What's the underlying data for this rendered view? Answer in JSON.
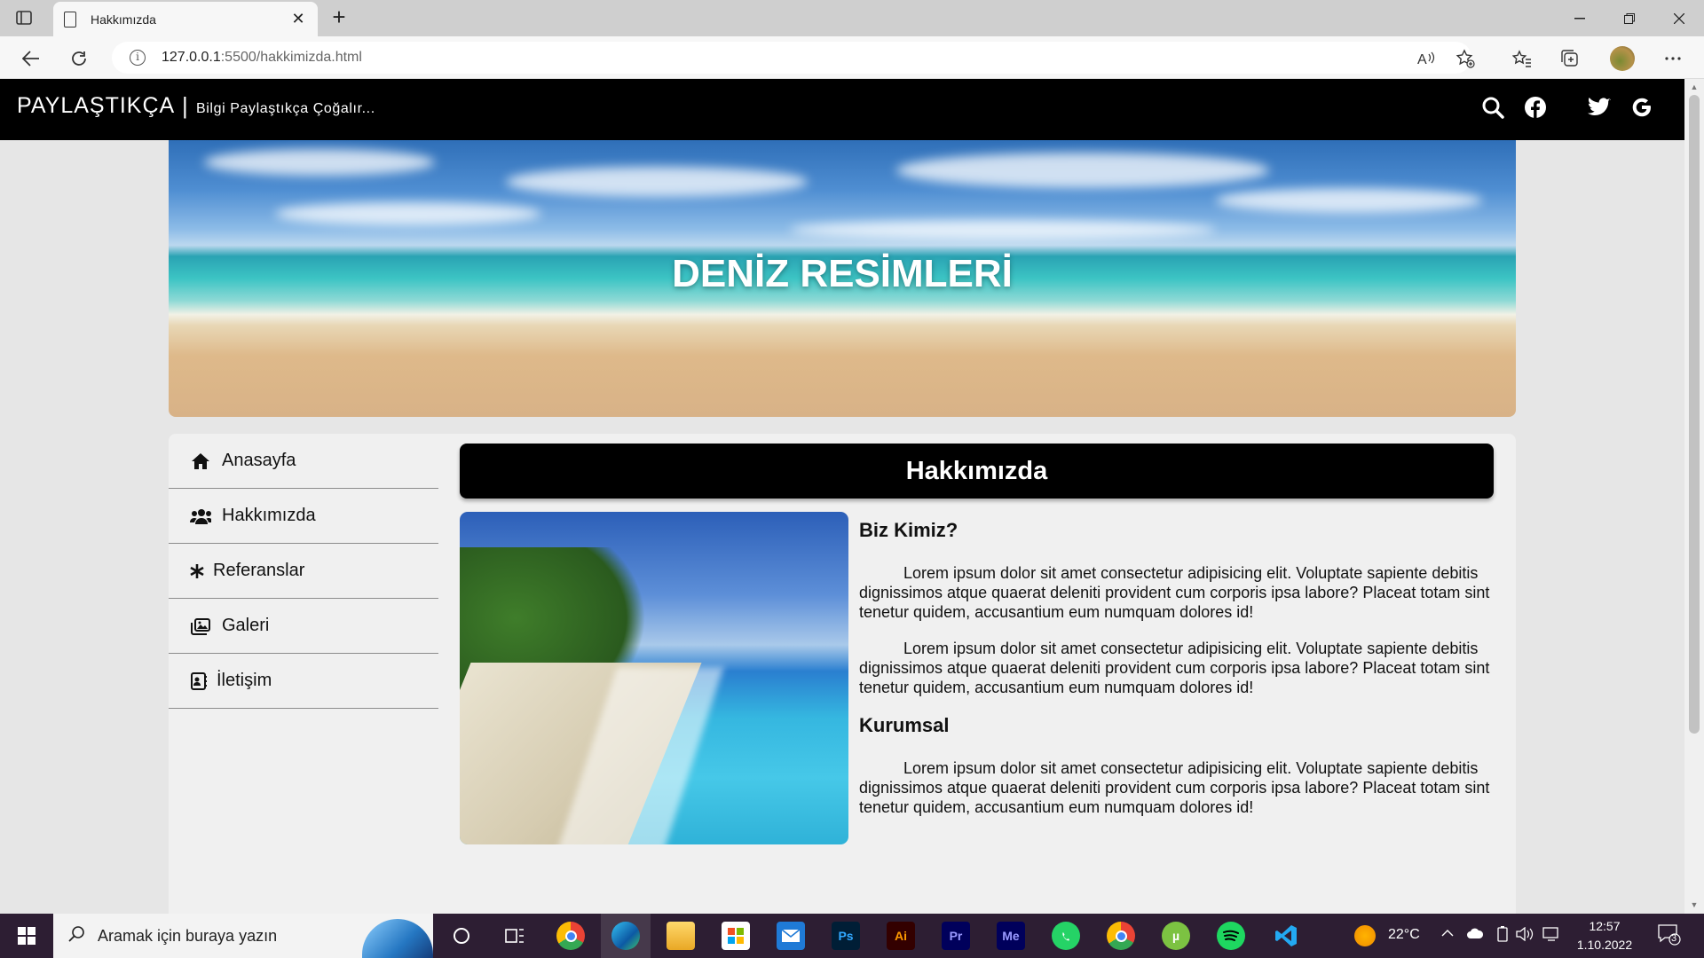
{
  "browser": {
    "tab_title": "Hakkımızda",
    "url_host": "127.0.0.1",
    "url_rest": ":5500/hakkimizda.html"
  },
  "site": {
    "brand": "PAYLAŞTIKÇA",
    "separator": "|",
    "slogan": "Bilgi Paylaştıkça Çoğalır...",
    "hero_title": "DENİZ RESİMLERİ"
  },
  "nav": {
    "items": [
      {
        "label": "Anasayfa",
        "icon": "home-icon"
      },
      {
        "label": "Hakkımızda",
        "icon": "users-icon"
      },
      {
        "label": "Referanslar",
        "icon": "asterisk-icon"
      },
      {
        "label": "Galeri",
        "icon": "images-icon"
      },
      {
        "label": "İletişim",
        "icon": "contact-card-icon"
      }
    ]
  },
  "main": {
    "heading": "Hakkımızda",
    "section1_title": "Biz Kimiz?",
    "section2_title": "Kurumsal",
    "lorem": "Lorem ipsum dolor sit amet consectetur adipisicing elit. Voluptate sapiente debitis dignissimos atque quaerat deleniti provident cum corporis ipsa labore? Placeat totam sint tenetur quidem, accusantium eum numquam dolores id!"
  },
  "taskbar": {
    "search_placeholder": "Aramak için buraya yazın",
    "temperature": "22°C",
    "time": "12:57",
    "date": "1.10.2022",
    "notification_count": "3"
  }
}
